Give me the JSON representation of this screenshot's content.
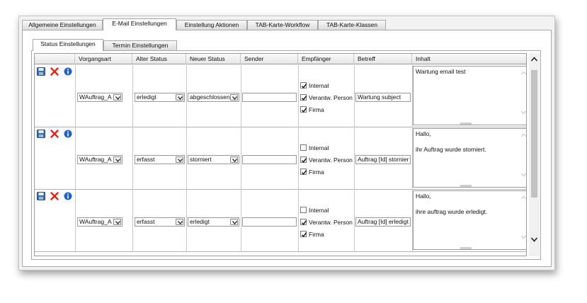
{
  "outer_tabs": [
    "Allgemeine Einstellungen",
    "E-Mail Einstellungen",
    "Einstellung Aktionen",
    "TAB-Karte-Workflow",
    "TAB-Karte-Klassen"
  ],
  "inner_tabs": [
    "Status Einstellungen",
    "Termin Einstellungen"
  ],
  "columns": [
    "Vorgangsart",
    "Alter Status",
    "Neuer Status",
    "Sender",
    "Empfänger",
    "Betreff",
    "Inhalt"
  ],
  "rows": [
    {
      "vorgangsart": "WAuftrag_A",
      "alter_status": "erledigt",
      "neuer_status": "abgeschlossen",
      "sender": "",
      "empfaenger": [
        {
          "label": "Internal",
          "checked": true
        },
        {
          "label": "Verantw. Person",
          "checked": true
        },
        {
          "label": "Firma",
          "checked": true
        }
      ],
      "betreff": "Wartung subject",
      "inhalt": [
        "Wartung email test"
      ]
    },
    {
      "vorgangsart": "WAuftrag_A",
      "alter_status": "erfasst",
      "neuer_status": "storniert",
      "sender": "",
      "empfaenger": [
        {
          "label": "Internal",
          "checked": false
        },
        {
          "label": "Verantw. Person",
          "checked": true
        },
        {
          "label": "Firma",
          "checked": true
        }
      ],
      "betreff": "Auftrag [Id] stornier",
      "inhalt": [
        "Hallo,",
        "",
        "ihr Auftrag wurde storniert."
      ]
    },
    {
      "vorgangsart": "WAuftrag_A",
      "alter_status": "erfasst",
      "neuer_status": "erledigt",
      "sender": "",
      "empfaenger": [
        {
          "label": "Internal",
          "checked": false
        },
        {
          "label": "Verantw. Person",
          "checked": true
        },
        {
          "label": "Firma",
          "checked": true
        }
      ],
      "betreff": "Auftrag [Id] erledigt",
      "inhalt": [
        "Hallo,",
        "",
        "ihre auftrag wurde erledigt."
      ]
    }
  ],
  "icons": {
    "save": "save-icon",
    "delete": "delete-icon",
    "info": "info-icon"
  },
  "colors": {
    "save": "#3a6ea5",
    "delete": "#e0241b",
    "info": "#1d63c7",
    "accent": "#2a5db0"
  }
}
